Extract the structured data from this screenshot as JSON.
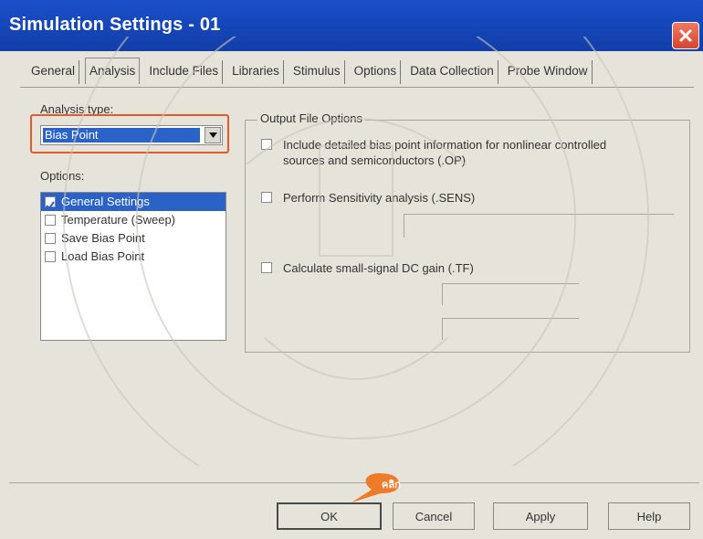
{
  "window": {
    "title": "Simulation Settings - 01"
  },
  "tabs": [
    "General",
    "Analysis",
    "Include Files",
    "Libraries",
    "Stimulus",
    "Options",
    "Data Collection",
    "Probe Window"
  ],
  "analysis_type": {
    "label": "Analysis type:",
    "value": "Bias Point"
  },
  "options": {
    "label": "Options:",
    "items": [
      "General Settings",
      "Temperature (Sweep)",
      "Save Bias Point",
      "Load Bias Point"
    ],
    "selected": "General Settings"
  },
  "output_file_options": {
    "title": "Output File Options",
    "include_detailed_line1": "Include detailed bias point information for nonlinear controlled",
    "include_detailed_line2": "sources and semiconductors (.OP)",
    "perform_sensitivity": "Perform Sensitivity analysis (.SENS)",
    "calculate_dc_gain": "Calculate small-signal DC gain (.TF)"
  },
  "buttons": {
    "ok": "OK",
    "cancel": "Cancel",
    "apply": "Apply",
    "help": "Help"
  },
  "annotation": {
    "callout_text": "คลิก"
  },
  "colors": {
    "titlebar": "#1546b8",
    "selection": "#2a62c8",
    "highlight": "#e45a2b"
  }
}
